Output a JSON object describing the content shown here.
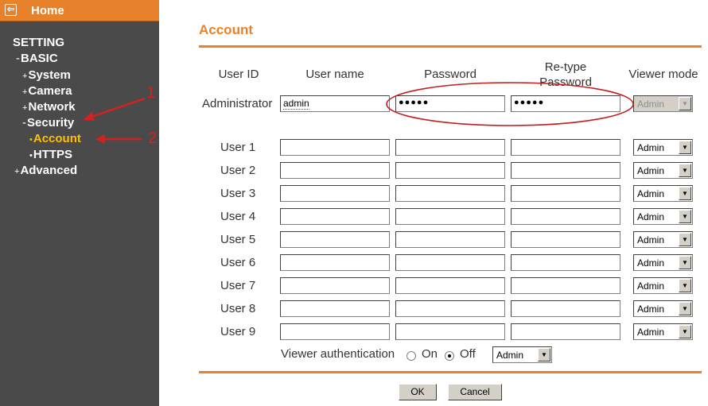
{
  "sidebar": {
    "home_label": "Home",
    "setting_label": "SETTING",
    "basic_label": "BASIC",
    "basic_prefix": "-",
    "items": [
      {
        "prefix": "+",
        "label": "System"
      },
      {
        "prefix": "+",
        "label": "Camera"
      },
      {
        "prefix": "+",
        "label": "Network"
      },
      {
        "prefix": "-",
        "label": "Security"
      },
      {
        "prefix": "•",
        "label": "Account"
      },
      {
        "prefix": "•",
        "label": "HTTPS"
      },
      {
        "prefix": "+",
        "label": "Advanced"
      }
    ]
  },
  "annotations": {
    "label_1": "1",
    "label_2": "2",
    "color": "#d42020"
  },
  "main": {
    "title": "Account",
    "accent_color": "#e8822a",
    "headers": {
      "user_id": "User ID",
      "user_name": "User name",
      "password": "Password",
      "retype_line1": "Re-type",
      "retype_line2": "Password",
      "viewer_mode": "Viewer mode"
    },
    "admin": {
      "label": "Administrator",
      "user_name": "admin",
      "password": "●●●●●",
      "retype": "●●●●●",
      "viewer_mode": "Admin"
    },
    "users": [
      {
        "label": "User 1",
        "user_name": "",
        "password": "",
        "retype": "",
        "viewer_mode": "Admin"
      },
      {
        "label": "User 2",
        "user_name": "",
        "password": "",
        "retype": "",
        "viewer_mode": "Admin"
      },
      {
        "label": "User 3",
        "user_name": "",
        "password": "",
        "retype": "",
        "viewer_mode": "Admin"
      },
      {
        "label": "User 4",
        "user_name": "",
        "password": "",
        "retype": "",
        "viewer_mode": "Admin"
      },
      {
        "label": "User 5",
        "user_name": "",
        "password": "",
        "retype": "",
        "viewer_mode": "Admin"
      },
      {
        "label": "User 6",
        "user_name": "",
        "password": "",
        "retype": "",
        "viewer_mode": "Admin"
      },
      {
        "label": "User 7",
        "user_name": "",
        "password": "",
        "retype": "",
        "viewer_mode": "Admin"
      },
      {
        "label": "User 8",
        "user_name": "",
        "password": "",
        "retype": "",
        "viewer_mode": "Admin"
      },
      {
        "label": "User 9",
        "user_name": "",
        "password": "",
        "retype": "",
        "viewer_mode": "Admin"
      }
    ],
    "viewer_auth": {
      "label": "Viewer authentication",
      "on_label": "On",
      "off_label": "Off",
      "selected": "Off",
      "mode": "Admin"
    },
    "buttons": {
      "ok": "OK",
      "cancel": "Cancel"
    }
  }
}
